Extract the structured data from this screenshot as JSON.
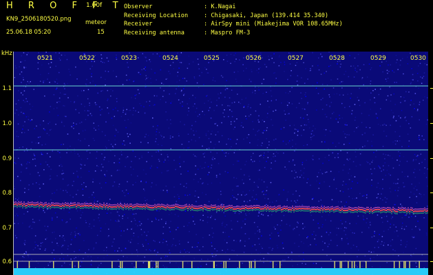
{
  "header": {
    "app_title": "H R O F F T",
    "version": "1.00f",
    "filename": "KN9_2506180520.png",
    "mode": "meteor",
    "datetime": "25.06.18 05:20",
    "count": "15"
  },
  "station": {
    "observer_label": "Observer",
    "observer_value": ": K.Nagai",
    "location_label": "Receiving Location",
    "location_value": ": Chigasaki, Japan (139.414 35.340)",
    "receiver_label": "Receiver",
    "receiver_value": ": AirSpy mini (Miakejima VOR 108.65MHz)",
    "antenna_label": "Receiving antenna",
    "antenna_value": ": Maspro FM-3"
  },
  "axis": {
    "unit": "kHz",
    "y_ticks": [
      "1.1",
      "1.0",
      "0.9",
      "0.8",
      "0.7",
      "0.6"
    ],
    "time_ticks": [
      "0521",
      "0522",
      "0523",
      "0524",
      "0525",
      "0526",
      "0527",
      "0528",
      "0529",
      "0530"
    ]
  },
  "colors": {
    "text": "#ffff44",
    "background": "#000000",
    "noise": "#0a0a78",
    "carrier": "#ff4444"
  }
}
